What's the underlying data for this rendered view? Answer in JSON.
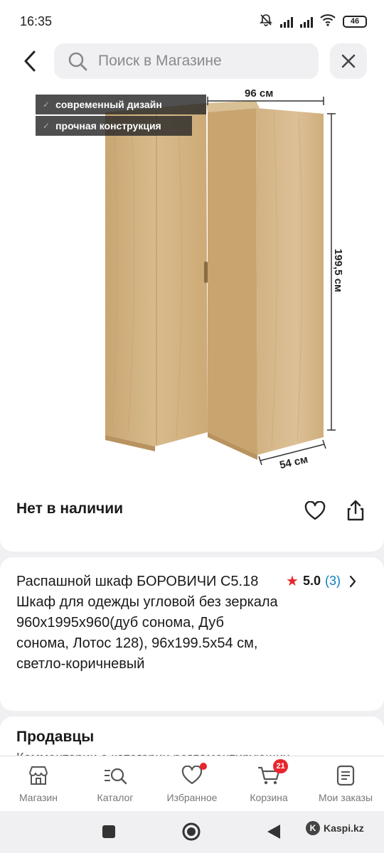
{
  "status_bar": {
    "time": "16:35",
    "battery": "46"
  },
  "header": {
    "search_placeholder": "Поиск в Магазине"
  },
  "product_image": {
    "features": [
      "современный дизайн",
      "прочная конструкция"
    ],
    "dimensions": {
      "width": "96 см",
      "height": "199,5 см",
      "depth": "54 см"
    },
    "carousel_active_index": 2,
    "carousel_count": 3
  },
  "availability": {
    "text": "Нет в наличии"
  },
  "product": {
    "title": "Распашной шкаф БОРОВИЧИ С5.18 Шкаф для одежды угловой без зеркала 960х1995х960(дуб сонома, Дуб сонома, Лотос 128), 96x199.5x54 см, светло-коричневый",
    "rating": "5.0",
    "review_count": "(3)"
  },
  "sellers": {
    "title": "Продавцы",
    "subtitle": "Комментарии о категории регламентирующих..."
  },
  "bottom_nav": {
    "items": [
      {
        "label": "Магазин",
        "icon": "store-icon"
      },
      {
        "label": "Каталог",
        "icon": "catalog-search-icon"
      },
      {
        "label": "Избранное",
        "icon": "heart-icon"
      },
      {
        "label": "Корзина",
        "icon": "cart-icon",
        "badge": "21"
      },
      {
        "label": "Мои заказы",
        "icon": "orders-icon"
      }
    ]
  },
  "watermark": "Kaspi.kz",
  "colors": {
    "accent_red": "#e8262d",
    "link_blue": "#0a7cc2",
    "wood": "#d4b483"
  }
}
